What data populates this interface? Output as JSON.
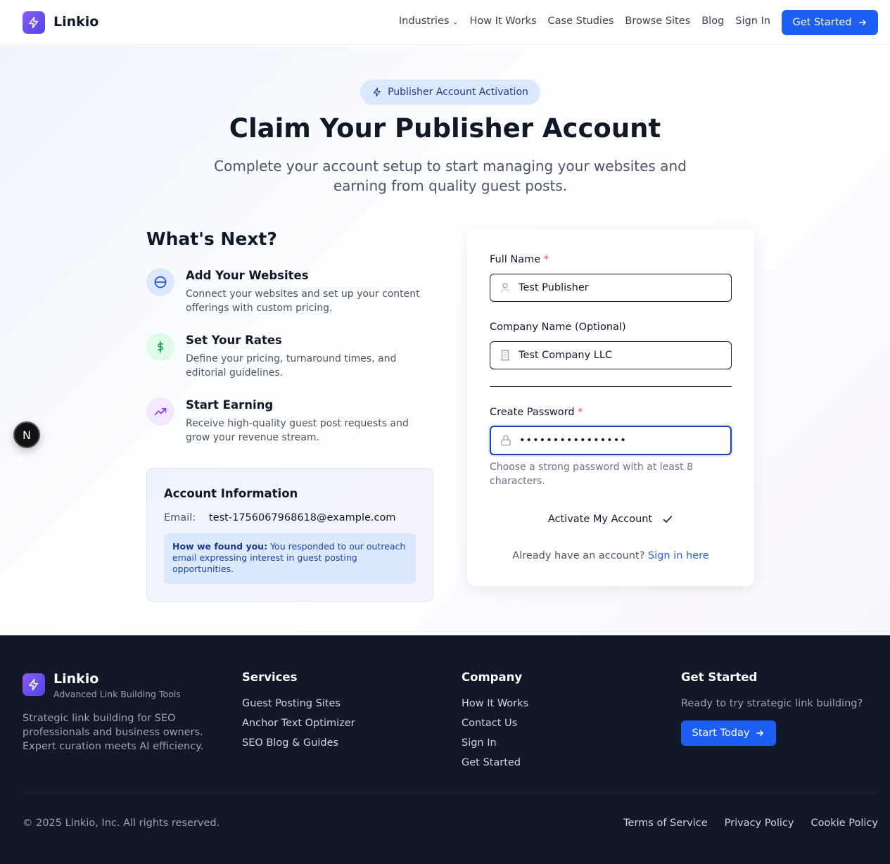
{
  "nav": {
    "brand": "Linkio",
    "links": [
      "Industries",
      "How It Works",
      "Case Studies",
      "Browse Sites",
      "Blog",
      "Sign In"
    ],
    "cta": "Get Started"
  },
  "hero": {
    "badge": "Publisher Account Activation",
    "title": "Claim Your Publisher Account",
    "subtitle": "Complete your account setup to start managing your websites and earning from quality guest posts."
  },
  "next": {
    "title": "What's Next?",
    "steps": [
      {
        "title": "Add Your Websites",
        "desc": "Connect your websites and set up your content offerings with custom pricing."
      },
      {
        "title": "Set Your Rates",
        "desc": "Define your pricing, turnaround times, and editorial guidelines."
      },
      {
        "title": "Start Earning",
        "desc": "Receive high-quality guest post requests and grow your revenue stream."
      }
    ]
  },
  "account": {
    "title": "Account Information",
    "email_label": "Email:",
    "email": "test-1756067968618@example.com",
    "found_label": "How we found you:",
    "found_text": "You responded to our outreach email expressing interest in guest posting opportunities."
  },
  "form": {
    "full_name_label": "Full Name",
    "full_name_value": "Test Publisher",
    "company_label": "Company Name (Optional)",
    "company_value": "Test Company LLC",
    "password_label": "Create Password",
    "password_mask": "••••••••••••••••",
    "required_mark": "*",
    "password_hint": "Choose a strong password with at least 8 characters.",
    "submit": "Activate My Account",
    "already": "Already have an account?",
    "signin": "Sign in here"
  },
  "fab": "N",
  "footer": {
    "brand": "Linkio",
    "tagline": "Advanced Link Building Tools",
    "desc": "Strategic link building for SEO professionals and business owners. Expert curation meets AI efficiency.",
    "services_title": "Services",
    "services": [
      "Guest Posting Sites",
      "Anchor Text Optimizer",
      "SEO Blog & Guides"
    ],
    "company_title": "Company",
    "company": [
      "How It Works",
      "Contact Us",
      "Sign In",
      "Get Started"
    ],
    "get_started_title": "Get Started",
    "ready": "Ready to try strategic link building?",
    "start_btn": "Start Today",
    "copyright": "© 2025 Linkio, Inc. All rights reserved.",
    "legal": [
      "Terms of Service",
      "Privacy Policy",
      "Cookie Policy"
    ]
  },
  "colors": {
    "primary": "#1d5ef5",
    "dark": "#111827",
    "badge_bg": "#dbe8fe",
    "required": "#ef4444"
  }
}
